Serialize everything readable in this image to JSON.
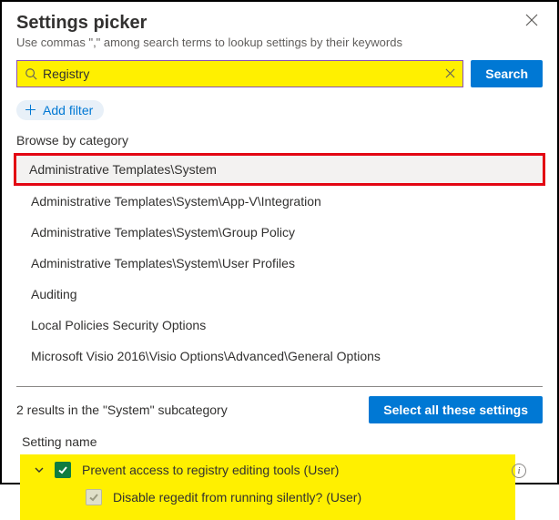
{
  "header": {
    "title": "Settings picker",
    "subtitle": "Use commas \",\" among search terms to lookup settings by their keywords"
  },
  "search": {
    "value": "Registry",
    "button": "Search"
  },
  "filter": {
    "add_label": "Add filter"
  },
  "browse": {
    "label": "Browse by category",
    "items": [
      "Administrative Templates\\System",
      "Administrative Templates\\System\\App-V\\Integration",
      "Administrative Templates\\System\\Group Policy",
      "Administrative Templates\\System\\User Profiles",
      "Auditing",
      "Local Policies Security Options",
      "Microsoft Visio 2016\\Visio Options\\Advanced\\General Options"
    ]
  },
  "results": {
    "summary": "2 results in the \"System\" subcategory",
    "select_all": "Select all these settings",
    "column": "Setting name",
    "items": [
      {
        "label": "Prevent access to registry editing tools (User)"
      },
      {
        "label": "Disable regedit from running silently? (User)"
      }
    ]
  }
}
